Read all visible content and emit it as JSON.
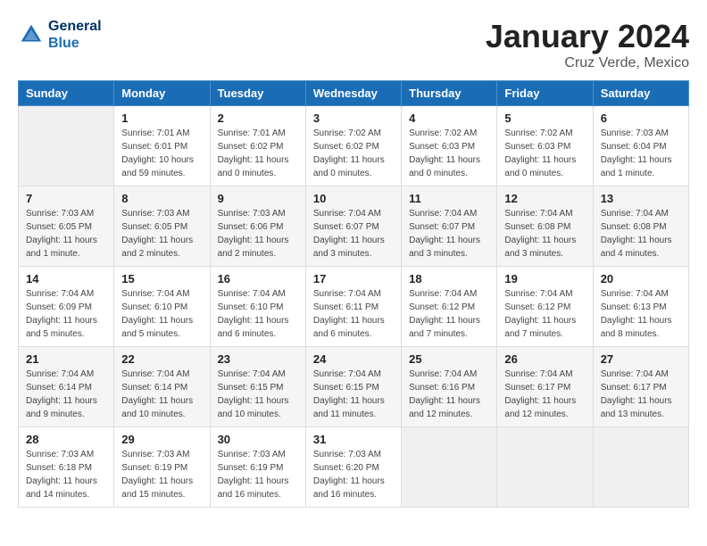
{
  "header": {
    "logo_line1": "General",
    "logo_line2": "Blue",
    "title": "January 2024",
    "subtitle": "Cruz Verde, Mexico"
  },
  "days_of_week": [
    "Sunday",
    "Monday",
    "Tuesday",
    "Wednesday",
    "Thursday",
    "Friday",
    "Saturday"
  ],
  "weeks": [
    [
      {
        "day": "",
        "info": ""
      },
      {
        "day": "1",
        "info": "Sunrise: 7:01 AM\nSunset: 6:01 PM\nDaylight: 10 hours\nand 59 minutes."
      },
      {
        "day": "2",
        "info": "Sunrise: 7:01 AM\nSunset: 6:02 PM\nDaylight: 11 hours\nand 0 minutes."
      },
      {
        "day": "3",
        "info": "Sunrise: 7:02 AM\nSunset: 6:02 PM\nDaylight: 11 hours\nand 0 minutes."
      },
      {
        "day": "4",
        "info": "Sunrise: 7:02 AM\nSunset: 6:03 PM\nDaylight: 11 hours\nand 0 minutes."
      },
      {
        "day": "5",
        "info": "Sunrise: 7:02 AM\nSunset: 6:03 PM\nDaylight: 11 hours\nand 0 minutes."
      },
      {
        "day": "6",
        "info": "Sunrise: 7:03 AM\nSunset: 6:04 PM\nDaylight: 11 hours\nand 1 minute."
      }
    ],
    [
      {
        "day": "7",
        "info": "Sunrise: 7:03 AM\nSunset: 6:05 PM\nDaylight: 11 hours\nand 1 minute."
      },
      {
        "day": "8",
        "info": "Sunrise: 7:03 AM\nSunset: 6:05 PM\nDaylight: 11 hours\nand 2 minutes."
      },
      {
        "day": "9",
        "info": "Sunrise: 7:03 AM\nSunset: 6:06 PM\nDaylight: 11 hours\nand 2 minutes."
      },
      {
        "day": "10",
        "info": "Sunrise: 7:04 AM\nSunset: 6:07 PM\nDaylight: 11 hours\nand 3 minutes."
      },
      {
        "day": "11",
        "info": "Sunrise: 7:04 AM\nSunset: 6:07 PM\nDaylight: 11 hours\nand 3 minutes."
      },
      {
        "day": "12",
        "info": "Sunrise: 7:04 AM\nSunset: 6:08 PM\nDaylight: 11 hours\nand 3 minutes."
      },
      {
        "day": "13",
        "info": "Sunrise: 7:04 AM\nSunset: 6:08 PM\nDaylight: 11 hours\nand 4 minutes."
      }
    ],
    [
      {
        "day": "14",
        "info": "Sunrise: 7:04 AM\nSunset: 6:09 PM\nDaylight: 11 hours\nand 5 minutes."
      },
      {
        "day": "15",
        "info": "Sunrise: 7:04 AM\nSunset: 6:10 PM\nDaylight: 11 hours\nand 5 minutes."
      },
      {
        "day": "16",
        "info": "Sunrise: 7:04 AM\nSunset: 6:10 PM\nDaylight: 11 hours\nand 6 minutes."
      },
      {
        "day": "17",
        "info": "Sunrise: 7:04 AM\nSunset: 6:11 PM\nDaylight: 11 hours\nand 6 minutes."
      },
      {
        "day": "18",
        "info": "Sunrise: 7:04 AM\nSunset: 6:12 PM\nDaylight: 11 hours\nand 7 minutes."
      },
      {
        "day": "19",
        "info": "Sunrise: 7:04 AM\nSunset: 6:12 PM\nDaylight: 11 hours\nand 7 minutes."
      },
      {
        "day": "20",
        "info": "Sunrise: 7:04 AM\nSunset: 6:13 PM\nDaylight: 11 hours\nand 8 minutes."
      }
    ],
    [
      {
        "day": "21",
        "info": "Sunrise: 7:04 AM\nSunset: 6:14 PM\nDaylight: 11 hours\nand 9 minutes."
      },
      {
        "day": "22",
        "info": "Sunrise: 7:04 AM\nSunset: 6:14 PM\nDaylight: 11 hours\nand 10 minutes."
      },
      {
        "day": "23",
        "info": "Sunrise: 7:04 AM\nSunset: 6:15 PM\nDaylight: 11 hours\nand 10 minutes."
      },
      {
        "day": "24",
        "info": "Sunrise: 7:04 AM\nSunset: 6:15 PM\nDaylight: 11 hours\nand 11 minutes."
      },
      {
        "day": "25",
        "info": "Sunrise: 7:04 AM\nSunset: 6:16 PM\nDaylight: 11 hours\nand 12 minutes."
      },
      {
        "day": "26",
        "info": "Sunrise: 7:04 AM\nSunset: 6:17 PM\nDaylight: 11 hours\nand 12 minutes."
      },
      {
        "day": "27",
        "info": "Sunrise: 7:04 AM\nSunset: 6:17 PM\nDaylight: 11 hours\nand 13 minutes."
      }
    ],
    [
      {
        "day": "28",
        "info": "Sunrise: 7:03 AM\nSunset: 6:18 PM\nDaylight: 11 hours\nand 14 minutes."
      },
      {
        "day": "29",
        "info": "Sunrise: 7:03 AM\nSunset: 6:19 PM\nDaylight: 11 hours\nand 15 minutes."
      },
      {
        "day": "30",
        "info": "Sunrise: 7:03 AM\nSunset: 6:19 PM\nDaylight: 11 hours\nand 16 minutes."
      },
      {
        "day": "31",
        "info": "Sunrise: 7:03 AM\nSunset: 6:20 PM\nDaylight: 11 hours\nand 16 minutes."
      },
      {
        "day": "",
        "info": ""
      },
      {
        "day": "",
        "info": ""
      },
      {
        "day": "",
        "info": ""
      }
    ]
  ]
}
